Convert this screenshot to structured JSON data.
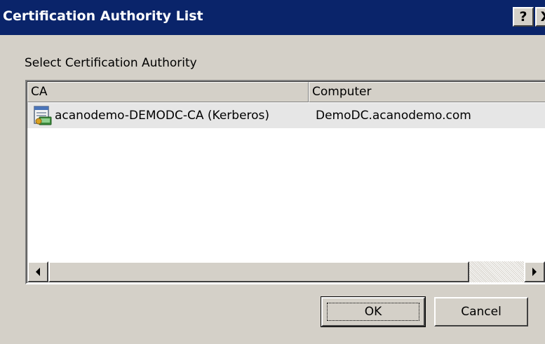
{
  "window": {
    "title": "Certification Authority List",
    "help_label": "?",
    "close_label": "X"
  },
  "main": {
    "select_label": "Select Certification Authority",
    "columns": [
      "CA",
      "Computer"
    ],
    "rows": [
      {
        "ca": "acanodemo-DEMODC-CA (Kerberos)",
        "computer": "DemoDC.acanodemo.com",
        "icon": "certificate-authority-icon"
      }
    ]
  },
  "buttons": {
    "ok": "OK",
    "cancel": "Cancel"
  }
}
